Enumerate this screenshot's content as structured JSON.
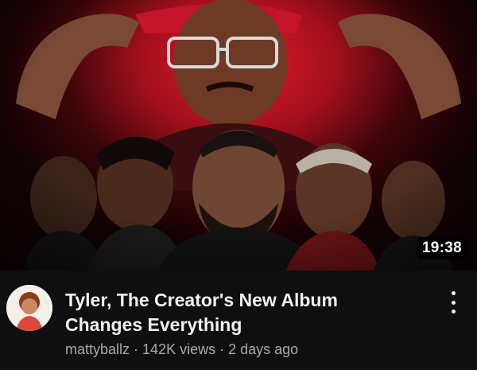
{
  "video": {
    "duration": "19:38",
    "title": "Tyler, The Creator's New Album Changes Everything",
    "channel": "mattyballz",
    "views": "142K views",
    "age": "2 days ago",
    "separator": "·"
  },
  "icons": {
    "more": "more-vert-icon",
    "avatar": "channel-avatar"
  },
  "colors": {
    "background": "#0f0f0f",
    "title": "#f1f1f1",
    "secondary": "#aaaaaa",
    "thumbnail_glow": "#e0182a"
  }
}
